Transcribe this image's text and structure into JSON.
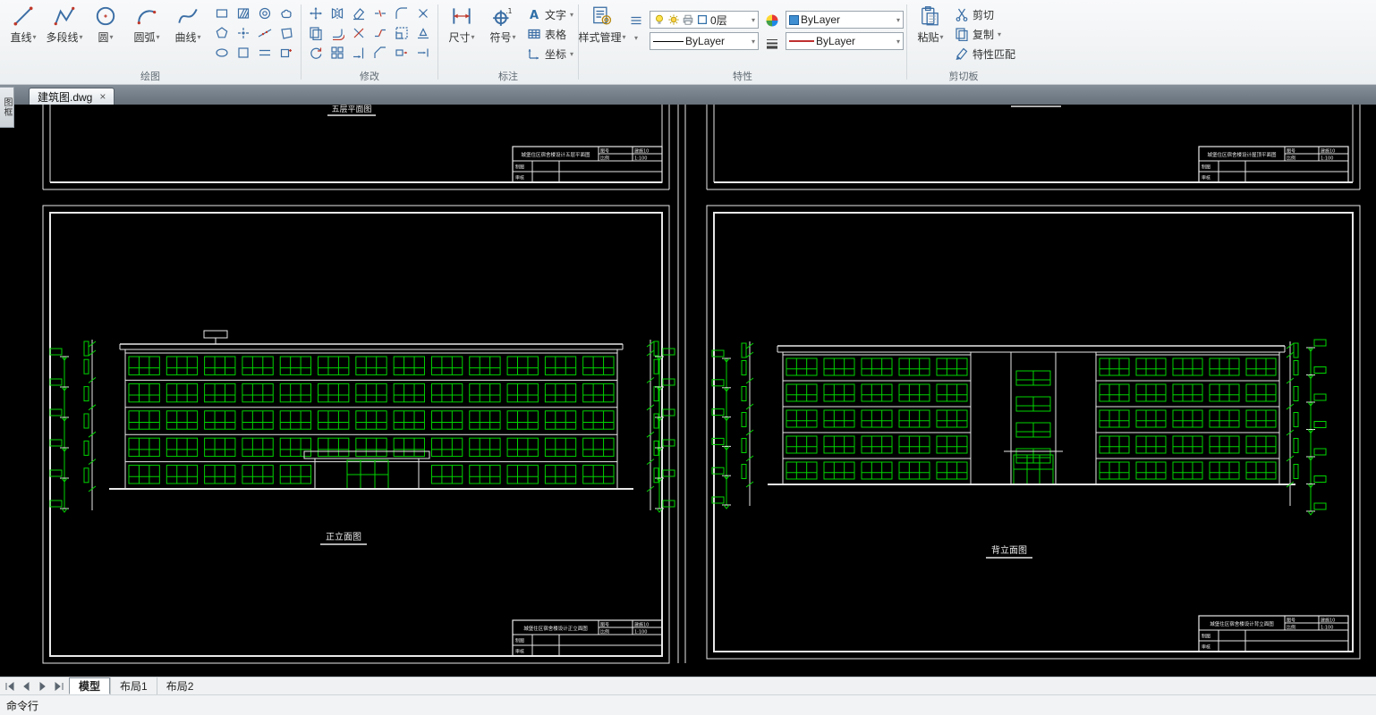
{
  "ribbon": {
    "groups": {
      "draw": {
        "label": "绘图",
        "big": [
          {
            "label": "直线",
            "icon": "line",
            "dd": true
          },
          {
            "label": "多段线",
            "icon": "polyline",
            "dd": true
          },
          {
            "label": "圆",
            "icon": "circle",
            "dd": true
          },
          {
            "label": "圆弧",
            "icon": "arc",
            "dd": true
          },
          {
            "label": "曲线",
            "icon": "spline",
            "dd": true
          }
        ],
        "minis": [
          "rectangle",
          "polygon",
          "ellipse",
          "hatch",
          "point",
          "region",
          "donut",
          "construction-line",
          "multiline",
          "revision-cloud",
          "wipeout",
          "block-insert"
        ]
      },
      "modify": {
        "label": "修改",
        "minis": [
          "move",
          "copy-obj",
          "rotate",
          "mirror",
          "offset",
          "array",
          "erase",
          "trim",
          "extend",
          "break",
          "join",
          "chamfer",
          "fillet",
          "scale",
          "stretch",
          "explode",
          "align",
          "lengthen"
        ]
      },
      "annotate": {
        "label": "标注",
        "big": [
          {
            "label": "尺寸",
            "icon": "dimension",
            "dd": true
          },
          {
            "label": "符号",
            "icon": "symbol",
            "dd": true
          }
        ],
        "small": [
          {
            "label": "文字",
            "icon": "text",
            "dd": true
          },
          {
            "label": "表格",
            "icon": "table",
            "dd": false
          },
          {
            "label": "坐标",
            "icon": "coordinate",
            "dd": true
          }
        ]
      },
      "properties": {
        "label": "特性",
        "style_manager": "样式管理",
        "layer_value": "0层",
        "color_value": "ByLayer",
        "linetype_value": "ByLayer",
        "lineweight_value": "ByLayer"
      },
      "clipboard": {
        "label": "剪切板",
        "paste": "粘贴",
        "cut": "剪切",
        "copy": "复制",
        "match": "特性匹配"
      }
    }
  },
  "doc_tab": {
    "title": "建筑图.dwg",
    "close": "×"
  },
  "side_tab": {
    "label": "图框"
  },
  "sheet_tabs": {
    "items": [
      "模型",
      "布局1",
      "布局2"
    ],
    "active": 0
  },
  "command_line": {
    "label": "命令行"
  },
  "drawing": {
    "colors": {
      "line": "#e8e8e8",
      "window": "#00d400"
    },
    "captions": {
      "front": "正立面图",
      "back": "背立面图",
      "top_left": "五层平面图"
    },
    "titleblock": {
      "titles": {
        "top_left": "城堡住区宿舍楼设计五层平面图",
        "top_right": "城堡住区宿舍楼设计屋顶平面图",
        "bottom_left": "城堡住区宿舍楼设计正立面图",
        "bottom_right": "城堡住区宿舍楼设计背立面图"
      },
      "no_label": "图号",
      "no_value": "建施10",
      "scale_label": "比例",
      "scale_value": "1:100",
      "draw_label": "制图",
      "check_label": "审核"
    },
    "front": {
      "floors": 5,
      "bays": 13
    },
    "back": {
      "floors": 5,
      "bays_side": 5
    }
  }
}
